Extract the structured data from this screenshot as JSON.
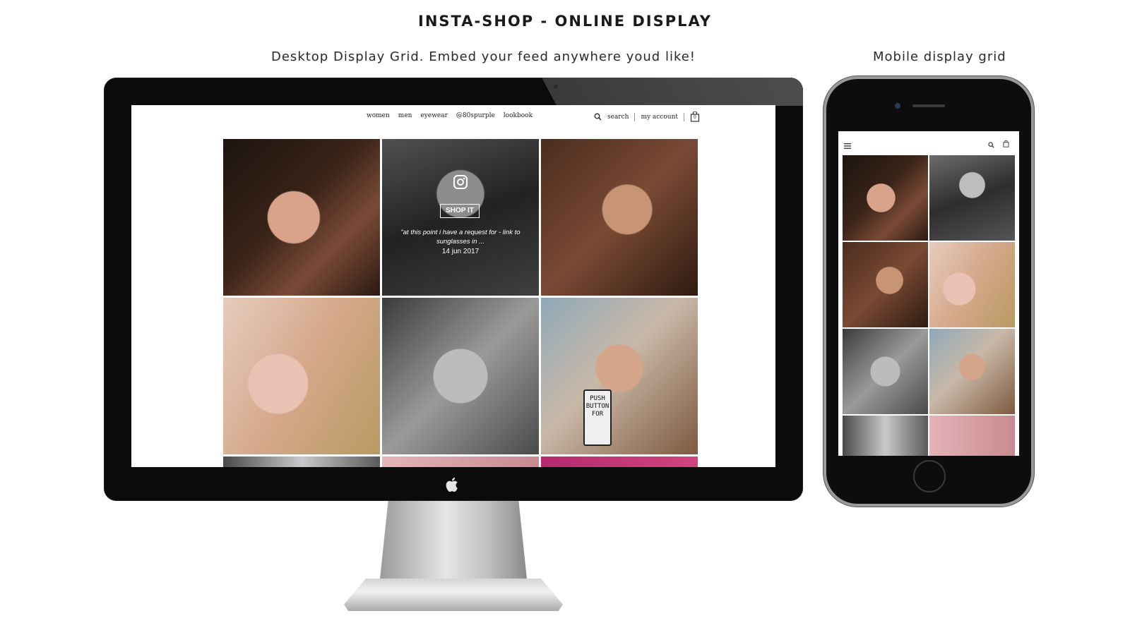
{
  "header": {
    "title": "INSTA-SHOP - ONLINE DISPLAY",
    "desktop_caption": "Desktop Display Grid. Embed your feed anywhere youd like!",
    "mobile_caption": "Mobile display grid"
  },
  "desktop": {
    "nav": {
      "links": [
        "women",
        "men",
        "eyewear",
        "@80spurple",
        "lookbook"
      ],
      "search_label": "search",
      "account_label": "my account",
      "cart_count": "0"
    },
    "featured_post": {
      "cta_label": "SHOP IT",
      "caption": "\"at this point i have a request for - link to sunglasses in ...",
      "date": "14 jun 2017"
    },
    "sign_text": "PUSH BUTTON FOR"
  },
  "mobile": {
    "icons": [
      "menu-icon",
      "search-icon",
      "bag-icon"
    ]
  },
  "colors": {
    "bezel": "#0b0b0b",
    "screen_bg": "#ffffff",
    "accent_purple": "#b52a6e"
  }
}
